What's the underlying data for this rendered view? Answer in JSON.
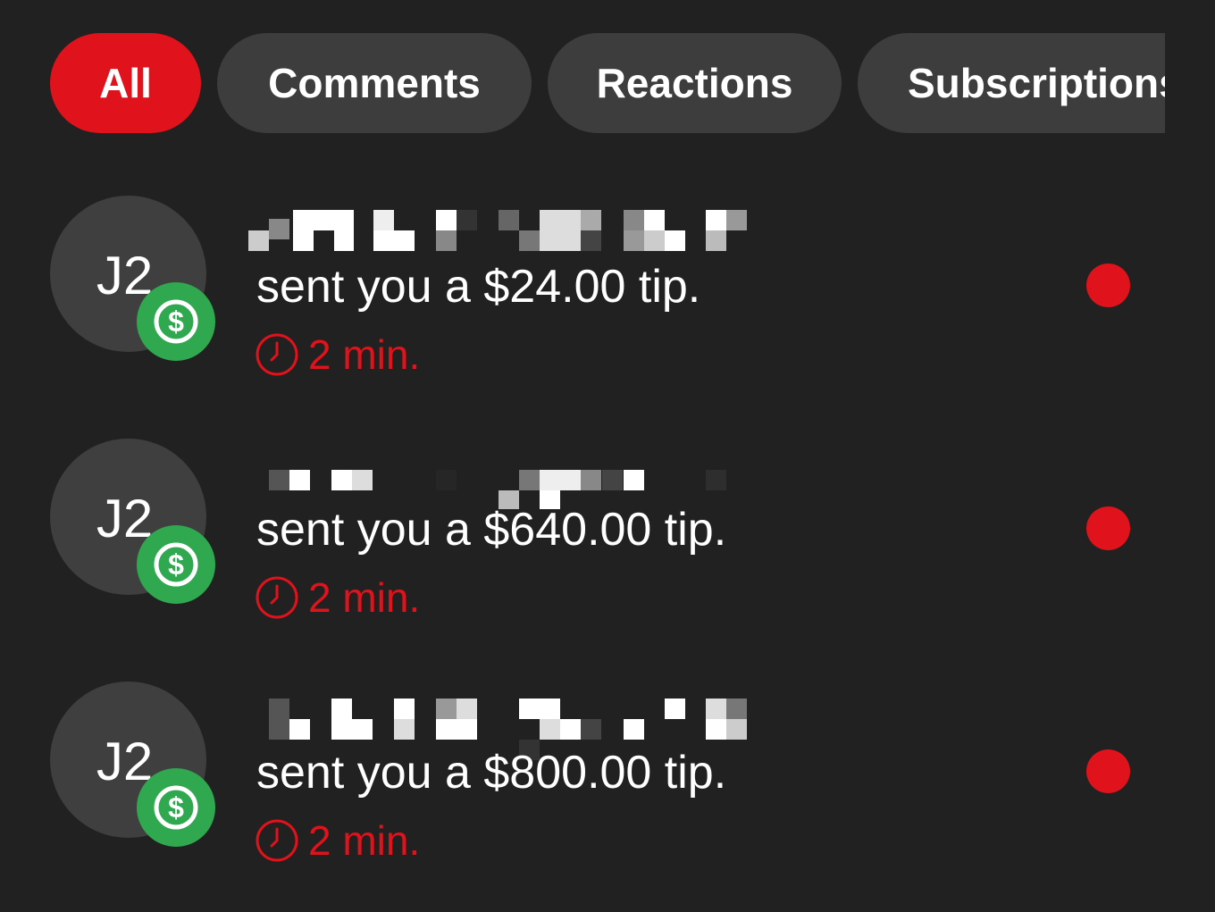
{
  "tabs": [
    {
      "label": "All",
      "active": true
    },
    {
      "label": "Comments",
      "active": false
    },
    {
      "label": "Reactions",
      "active": false
    },
    {
      "label": "Subscriptions",
      "active": false
    }
  ],
  "notifications": [
    {
      "avatar_text": "J2",
      "badge_icon": "dollar-icon",
      "message": "sent you a $24.00 tip.",
      "time": "2 min.",
      "unread": true
    },
    {
      "avatar_text": "J2",
      "badge_icon": "dollar-icon",
      "message": "sent you a $640.00 tip.",
      "time": "2 min.",
      "unread": true
    },
    {
      "avatar_text": "J2",
      "badge_icon": "dollar-icon",
      "message": "sent you a $800.00 tip.",
      "time": "2 min.",
      "unread": true
    }
  ],
  "colors": {
    "background": "#212121",
    "accent": "#e0121b",
    "tab_inactive": "#3d3d3d",
    "avatar": "#3f3f3f",
    "badge": "#2fa84f"
  }
}
